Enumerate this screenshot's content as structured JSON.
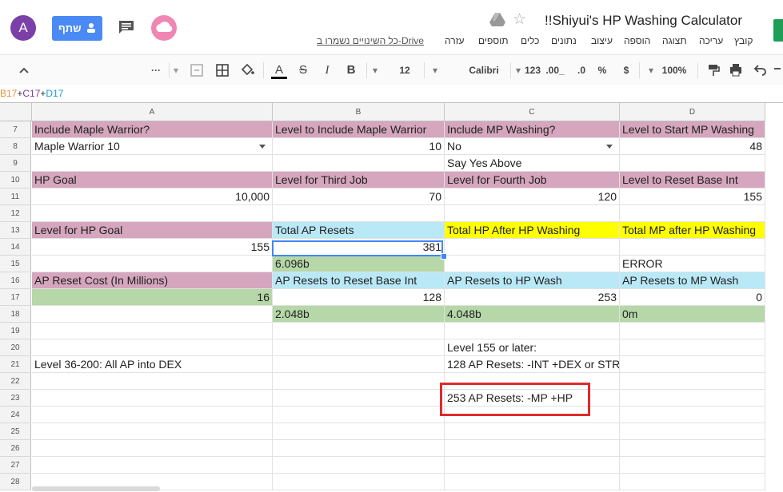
{
  "header": {
    "avatar_letter": "A",
    "share_label": "שתף",
    "doc_title": "!!Shiyui's HP Washing Calculator",
    "saved_text": "כל השינויים נשמרו ב-Drive",
    "menu": [
      "קובץ",
      "עריכה",
      "תצוגה",
      "הוספה",
      "עיצוב",
      "נתונים",
      "כלים",
      "תוספים",
      "עזרה"
    ]
  },
  "toolbar": {
    "zoom": "100%",
    "currency": "$",
    "percent": "%",
    "decimals": ".00_",
    "format_123": "123",
    "font": "Calibri",
    "font_size": "12",
    "bold": "B",
    "italic": "I",
    "strike": "S",
    "text_color": "A",
    "more": "···"
  },
  "formula_bar": {
    "parts": [
      {
        "text": "B17",
        "color": "#e69138"
      },
      {
        "text": "+",
        "color": "#333333"
      },
      {
        "text": "C17",
        "color": "#7b3fa8"
      },
      {
        "text": "+",
        "color": "#333333"
      },
      {
        "text": "D17",
        "color": "#1a9fd0"
      }
    ]
  },
  "columns": [
    "A",
    "B",
    "C",
    "D"
  ],
  "rows": [
    "7",
    "8",
    "9",
    "10",
    "11",
    "12",
    "13",
    "14",
    "15",
    "16",
    "17",
    "18",
    "19",
    "20",
    "21",
    "22",
    "23",
    "24",
    "25",
    "26",
    "27",
    "28"
  ],
  "cells": {
    "r7": {
      "a": "Include Maple Warrior?",
      "b": "Level to Include Maple Warrior",
      "c": "Include MP Washing?",
      "d": "Level to Start MP Washing"
    },
    "r8": {
      "a": "Maple Warrior 10",
      "b": "10",
      "c": "No",
      "d": "48"
    },
    "r9": {
      "c": "Say Yes Above"
    },
    "r10": {
      "a": "HP Goal",
      "b": "Level for Third Job",
      "c": "Level for Fourth Job",
      "d": "Level to Reset Base Int"
    },
    "r11": {
      "a": "10,000",
      "b": "70",
      "c": "120",
      "d": "155"
    },
    "r13": {
      "a": "Level for HP Goal",
      "b": "Total AP Resets",
      "c": "Total HP After HP Washing",
      "d": "Total MP after HP Washing"
    },
    "r14": {
      "a": "155",
      "b": "381"
    },
    "r15": {
      "b": "6.096b",
      "d": "ERROR"
    },
    "r16": {
      "a": "AP Reset Cost (In Millions)",
      "b": "AP Resets to Reset Base Int",
      "c": "AP Resets to HP Wash",
      "d": "AP Resets to MP Wash"
    },
    "r17": {
      "a": "16",
      "b": "128",
      "c": "253",
      "d": "0"
    },
    "r18": {
      "b": "2.048b",
      "c": "4.048b",
      "d": "0m"
    },
    "r20": {
      "c": "Level 155 or later:"
    },
    "r21": {
      "a": "Level 36-200: All AP into DEX",
      "c": "128 AP Resets: -INT +DEX or STR"
    },
    "r23": {
      "c": "253 AP Resets: -MP +HP"
    }
  },
  "colors": {
    "pink": "#d5a6bd",
    "blue": "#b9e8f6",
    "yellow": "#ffff00",
    "green": "#b6d7a8",
    "share_button": "#4a8af4",
    "selection": "#4285f4",
    "highlight_box": "#e02a2a"
  }
}
